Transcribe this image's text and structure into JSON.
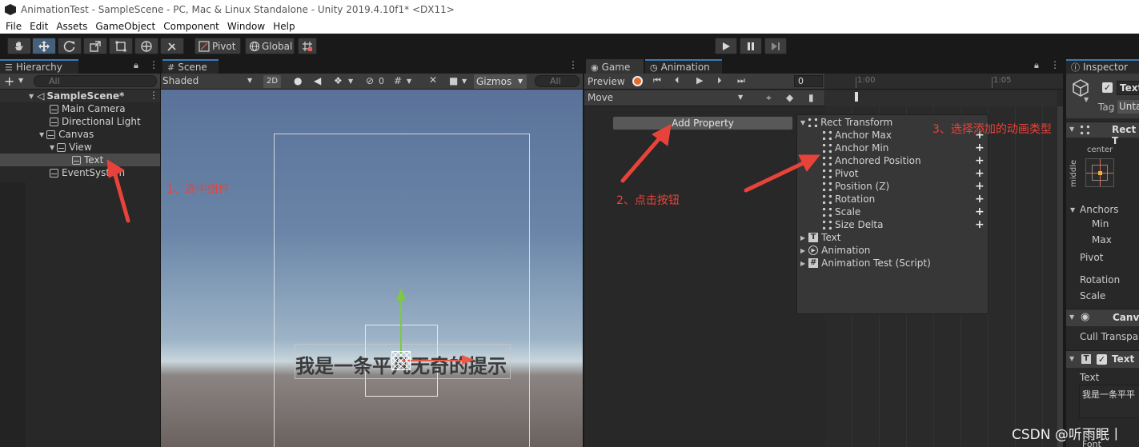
{
  "window": {
    "title": "AnimationTest - SampleScene - PC, Mac & Linux Standalone - Unity 2019.4.10f1* <DX11>"
  },
  "menu": [
    "File",
    "Edit",
    "Assets",
    "GameObject",
    "Component",
    "Window",
    "Help"
  ],
  "toolbar": {
    "pivot": "Pivot",
    "global": "Global"
  },
  "hierarchy": {
    "tab": "Hierarchy",
    "search_placeholder": "All",
    "scene": "SampleScene*",
    "items": [
      "Main Camera",
      "Directional Light",
      "Canvas",
      "View",
      "Text",
      "EventSystem"
    ]
  },
  "scene_view": {
    "tab": "Scene",
    "shading": "Shaded",
    "mode_2d": "2D",
    "hidden_count": "0",
    "gizmos": "Gizmos",
    "search_placeholder": "All",
    "canvas_text": "我是一条平凡无奇的提示"
  },
  "animation": {
    "tab_game": "Game",
    "tab_animation": "Animation",
    "preview": "Preview",
    "frame": "0",
    "clip": "Move",
    "ruler": [
      "1:00",
      "1:05"
    ],
    "add_property": "Add Property",
    "component_rect": "Rect Transform",
    "properties": [
      "Anchor Max",
      "Anchor Min",
      "Anchored Position",
      "Pivot",
      "Position (Z)",
      "Rotation",
      "Scale",
      "Size Delta"
    ],
    "other_components": [
      "Text",
      "Animation",
      "Animation Test (Script)"
    ]
  },
  "inspector": {
    "tab": "Inspector",
    "name": "Text",
    "tag_label": "Tag",
    "tag_value": "Unta",
    "rect_header": "Rect T",
    "anchor_h": "center",
    "anchor_v": "middle",
    "anchors": "Anchors",
    "min": "Min",
    "max": "Max",
    "pivot": "Pivot",
    "rotation": "Rotation",
    "scale": "Scale",
    "canvas_header": "Canva",
    "cull": "Cull Transpar",
    "text_header": "Text",
    "text_label": "Text",
    "text_value": "我是一条平平",
    "font": "Font"
  },
  "annotations": {
    "step1": "1、选中组件",
    "step2": "2、点击按钮",
    "step3": "3、选择添加的动画类型"
  },
  "watermark": "CSDN @听雨眠丨"
}
